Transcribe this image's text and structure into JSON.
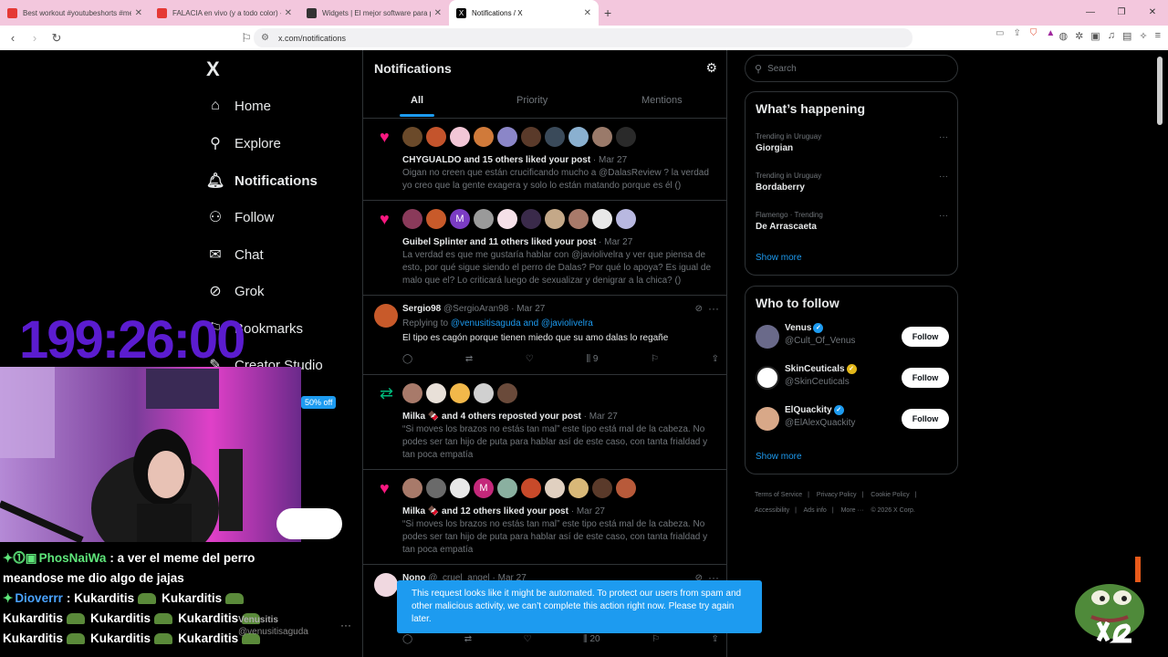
{
  "browser": {
    "tabs": [
      {
        "title": "Best workout #youtubeshorts #meny",
        "icon_color": "#e53935"
      },
      {
        "title": "FALACIA en vivo (y a todo color) - Ra",
        "icon_color": "#e53935"
      },
      {
        "title": "Widgets | El mejor software para pot",
        "icon_color": "#333333"
      },
      {
        "title": "Notifications / X",
        "icon_color": "#000000"
      }
    ],
    "url": "x.com/notifications"
  },
  "sidebar": {
    "logo": "X",
    "items": [
      {
        "label": "Home",
        "icon": "home-icon"
      },
      {
        "label": "Explore",
        "icon": "search-icon"
      },
      {
        "label": "Notifications",
        "icon": "bell-icon"
      },
      {
        "label": "Follow",
        "icon": "person-add-icon"
      },
      {
        "label": "Chat",
        "icon": "mail-icon"
      },
      {
        "label": "Grok",
        "icon": "grok-icon"
      },
      {
        "label": "Bookmarks",
        "icon": "bookmark-icon"
      },
      {
        "label": "Creator Studio",
        "icon": "creator-icon"
      }
    ],
    "promo": "50% off"
  },
  "overlay": {
    "timer": "199:26:00",
    "chat": [
      {
        "user": "PhosNaiWa",
        "text": ": a ver el meme del perro",
        "cont": "meandose me dio algo de jajas"
      },
      {
        "user": "Dioverrr",
        "text": ": Kukarditis",
        "spam": "Kukarditis"
      }
    ],
    "ghost_name": "Venusitis",
    "ghost_handle": "@venusitisaguda"
  },
  "main": {
    "title": "Notifications",
    "tabs": [
      "All",
      "Priority",
      "Mentions"
    ],
    "notifications": [
      {
        "type": "like",
        "who": "CHYGUALDO",
        "action": " and 15 others liked your post",
        "date": " · Mar 27",
        "text": "Oigan no creen que están crucificando mucho a @DalasReview ?  la verdad yo creo que la gente exagera y solo lo están matando porque es él ()"
      },
      {
        "type": "like",
        "who": "Guibel Splinter",
        "action": " and 11 others liked your post",
        "date": " · Mar 27",
        "text": "La verdad es que me gustaría hablar con @javiolivelra y ver que piensa de esto, por qué sigue siendo el perro de Dalas? Por qué lo apoya? Es igual de malo que el? Lo criticará luego de sexualizar y denigrar a la chica? ()"
      },
      {
        "type": "reply",
        "name": "Sergio98",
        "handle": "@SergioAran98",
        "date": " · Mar 27",
        "replying_label": "Replying to ",
        "replying_to": "@venusitisaguda and @javiolivelra",
        "text": "El tipo es cagón porque tienen miedo que su amo dalas lo regañe",
        "views": "9"
      },
      {
        "type": "repost",
        "who": "Milka 🍫",
        "action": " and 4 others reposted your post",
        "date": " · Mar 27",
        "text": "“Si moves los brazos no estás tan mal” este tipo está mal de la cabeza. No podes ser tan hijo de puta para hablar así de este caso, con tanta frialdad y tan poca empatía"
      },
      {
        "type": "like",
        "who": "Milka 🍫",
        "action": " and 12 others liked your post",
        "date": " · Mar 27",
        "text": "“Si moves los brazos no estás tan mal” este tipo está mal de la cabeza. No podes ser tan hijo de puta para hablar así de este caso, con tanta frialdad y tan poca empatía"
      },
      {
        "type": "reply",
        "name": "Nono",
        "handle": "@_cruel_angel",
        "date": " · Mar 27",
        "views": "20"
      }
    ]
  },
  "right": {
    "search_placeholder": "Search",
    "happening_title": "What’s happening",
    "trends": [
      {
        "meta": "Trending in Uruguay",
        "name": "Giorgian"
      },
      {
        "meta": "Trending in Uruguay",
        "name": "Bordaberry"
      },
      {
        "meta": "Flamengo · Trending",
        "name": "De Arrascaeta"
      }
    ],
    "show_more": "Show more",
    "wtf_title": "Who to follow",
    "follow_label": "Follow",
    "who_to_follow": [
      {
        "name": "Venus",
        "handle": "@Cult_Of_Venus",
        "badge": "blue"
      },
      {
        "name": "SkinCeuticals",
        "handle": "@SkinCeuticals",
        "badge": "gold"
      },
      {
        "name": "ElQuackity",
        "handle": "@ElAlexQuackity",
        "badge": "blue"
      }
    ],
    "footer": [
      "Terms of Service",
      "|",
      "Privacy Policy",
      "|",
      "Cookie Policy",
      "|",
      "Accessibility",
      "|",
      "Ads info",
      "|",
      "More ···",
      "© 2026 X Corp."
    ]
  },
  "toast": "This request looks like it might be automated. To protect our users from spam and other malicious activity, we can’t complete this action right now. Please try again later.",
  "colors": {
    "accent": "#1d9bf0",
    "like": "#f91880",
    "repost": "#00ba7c",
    "timer": "#5b1ccf"
  }
}
